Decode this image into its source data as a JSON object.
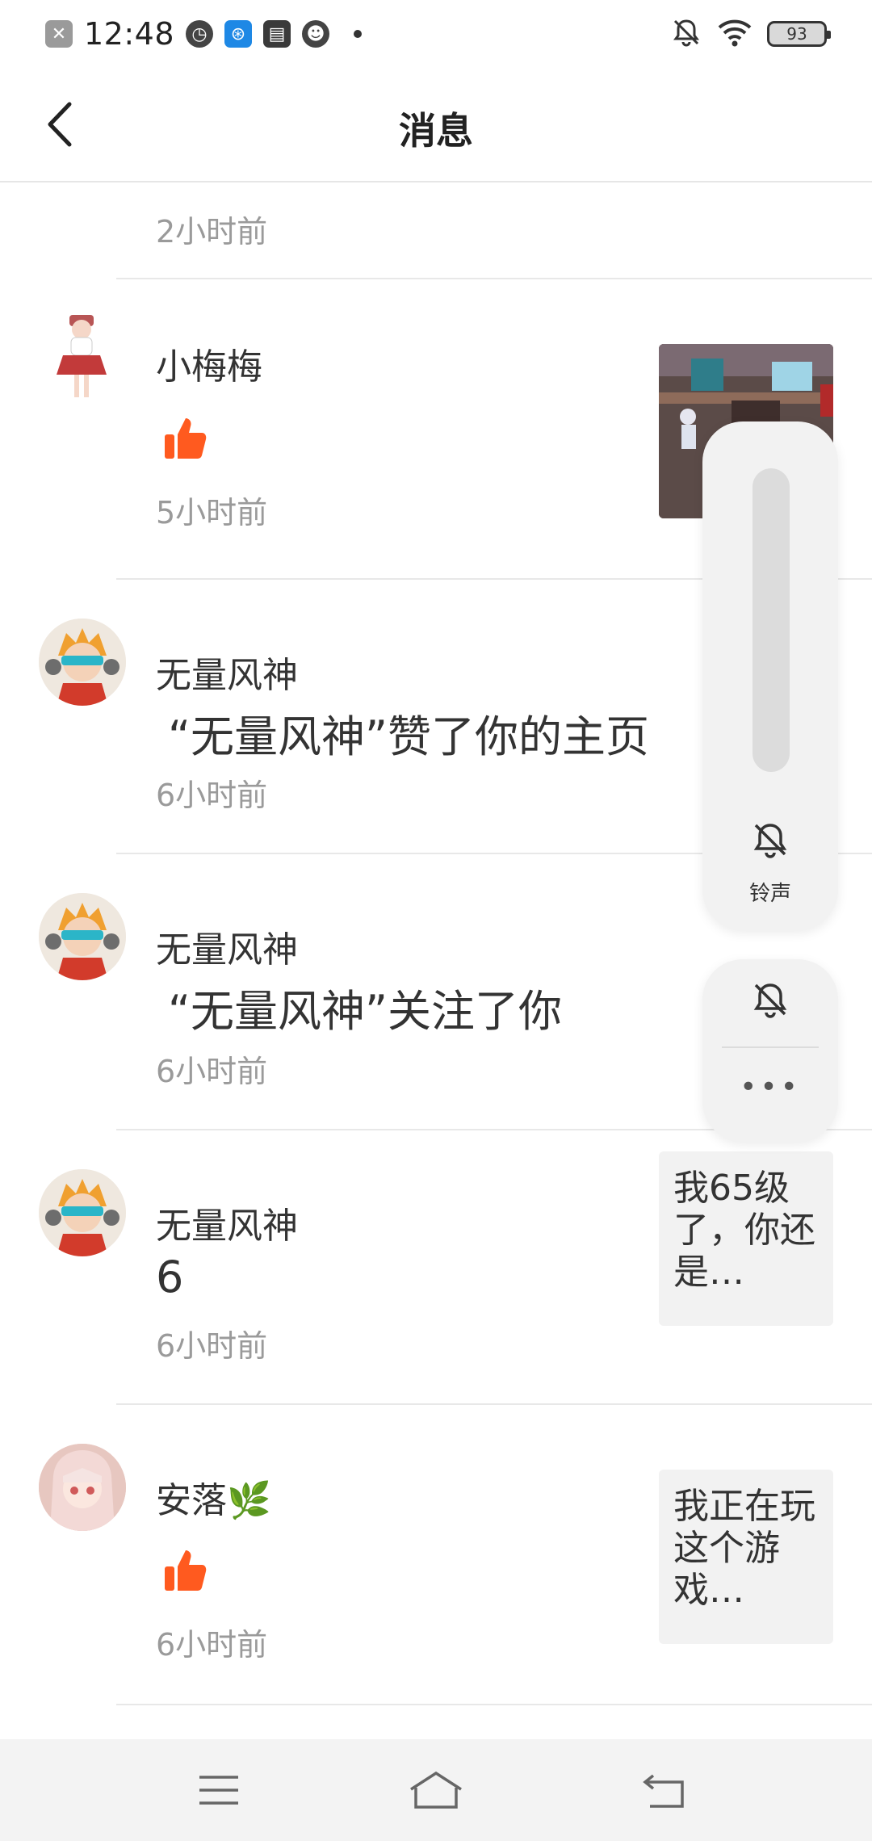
{
  "status_bar": {
    "time": "12:48",
    "battery": "93",
    "icons": [
      "close-app-icon",
      "speed-icon",
      "signal-app-icon",
      "book-icon",
      "bot-icon",
      "notification-dot",
      "mute-icon",
      "wifi-icon",
      "battery-icon"
    ]
  },
  "header": {
    "title": "消息",
    "back_icon": "chevron-left-icon"
  },
  "messages": [
    {
      "time": "2小时前"
    },
    {
      "name": "小梅梅",
      "content": "",
      "type": "like",
      "time": "5小时前",
      "attachment": "image"
    },
    {
      "name": "无量风神",
      "content": "“无量风神”赞了你的主页",
      "type": "text",
      "time": "6小时前"
    },
    {
      "name": "无量风神",
      "content": "“无量风神”关注了你",
      "type": "text",
      "time": "6小时前"
    },
    {
      "name": "无量风神",
      "content": "6",
      "type": "text",
      "time": "6小时前",
      "side_text": "我65级了，你还是…"
    },
    {
      "name": "安落🌿",
      "content": "",
      "type": "like",
      "time": "6小时前",
      "side_text": "我正在玩这个游戏…"
    }
  ],
  "volume_panel": {
    "label": "铃声",
    "level": 0,
    "more": "•••"
  },
  "colors": {
    "accent": "#ff5a1f",
    "secondary_text": "#9a9a9a"
  },
  "nav": {
    "items": [
      "menu-icon",
      "home-icon",
      "back-icon"
    ]
  }
}
